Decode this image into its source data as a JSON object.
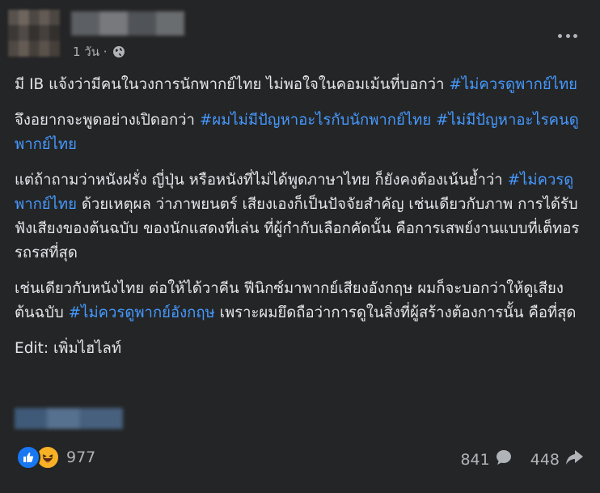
{
  "post": {
    "timestamp": "1 วัน ·",
    "privacy_icon": "globe-icon",
    "more_icon": "more-options-icon",
    "paragraphs": [
      {
        "text_before": "มี IB แจ้งว่ามีคนในวงการนักพากย์ไทย ไม่พอใจในคอมเม้นที่บอกว่า ",
        "hashtag": "#ไม่ควรดูพากย์ไทย",
        "text_after": ""
      },
      {
        "text_before": "จึงอยากจะพูดอย่างเปิดอกว่า ",
        "hashtag": "#ผมไม่มีปัญหาอะไรกับนักพากย์ไทย",
        "middle": " ",
        "hashtag2": "#ไม่มีปัญหาอะไรคนดูพากย์ไทย",
        "text_after": ""
      },
      {
        "text_before": "แต่ถ้าถามว่าหนังฝรั่ง ญี่ปุ่น หรือหนังที่ไม่ได้พูดภาษาไทย ก็ยังคงต้องเน้นย้ำว่า ",
        "hashtag": "#ไม่ควรดูพากย์ไทย",
        "text_after": " ด้วยเหตุผล ว่าภาพยนตร์ เสียงเองก็เป็นปัจจัยสำคัญ เช่นเดียวกับภาพ การได้รับฟังเสียงของต้นฉบับ ของนักแสดงที่เล่น ที่ผู้กำกับเลือกคัดนั้น   คือการเสพย์งานแบบที่เต็ทอรรถรสที่สุด"
      },
      {
        "text_before": "เช่นเดียวกับหนังไทย ต่อให้ได้วาคีน ฟีนิกซ์มาพากย์เสียงอังกฤษ ผมก็จะบอกว่าให้ดูเสียงต้นฉบับ ",
        "hashtag": "#ไม่ควรดูพากย์อังกฤษ",
        "text_after": " เพราะผมยึดถือว่าการดูในสิ่งที่ผู้สร้างต้องการนั้น คือที่สุด"
      }
    ],
    "edit_note": "Edit: เพิ่มไฮไลท์"
  },
  "footer": {
    "reaction_icons": [
      "like-icon",
      "haha-icon"
    ],
    "reaction_count": "977",
    "comment_count": "841",
    "share_count": "448",
    "comment_icon": "comment-icon",
    "share_icon": "share-icon"
  },
  "colors": {
    "background": "#242526",
    "text": "#e4e6eb",
    "secondary_text": "#b0b3b8",
    "hashtag": "#4599ff",
    "like_blue": "#1877f2",
    "haha_yellow": "#f7b125"
  }
}
